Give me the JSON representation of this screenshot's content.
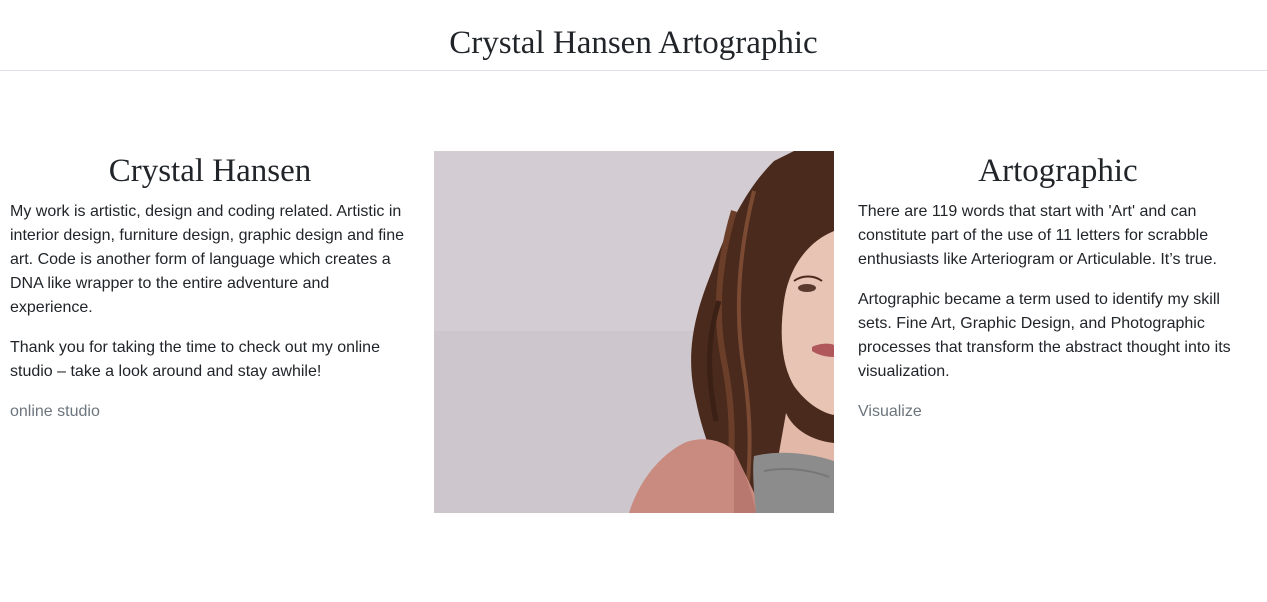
{
  "header": {
    "title": "Crystal Hansen Artographic"
  },
  "left": {
    "heading": "Crystal Hansen",
    "paragraphs": [
      "My work is artistic, design and coding related. Artistic in interior design, furniture design, graphic design and fine art. Code is another form of language which creates a DNA like wrapper to the entire adventure and experience.",
      "Thank you for taking the time to check out my online studio – take a look around and stay awhile!"
    ],
    "link_label": "online studio"
  },
  "center": {
    "image_icon": "portrait-photo"
  },
  "right": {
    "heading": "Artographic",
    "paragraphs": [
      "There are 119 words that start with 'Art' and can constitute part of the use of 11 letters for scrabble enthusiasts like Arteriogram or Articulable. It’s true.",
      "Artographic became a term used to identify my skill sets. Fine Art, Graphic Design, and Photographic processes that transform the abstract thought into its visualization."
    ],
    "link_label": "Visualize"
  },
  "colors": {
    "text": "#212529",
    "muted_link": "#6c757d",
    "divider": "#dee2e6",
    "photo_background": "#d2ccd2",
    "hair": "#4a2a1c",
    "jacket": "#c98a80"
  }
}
